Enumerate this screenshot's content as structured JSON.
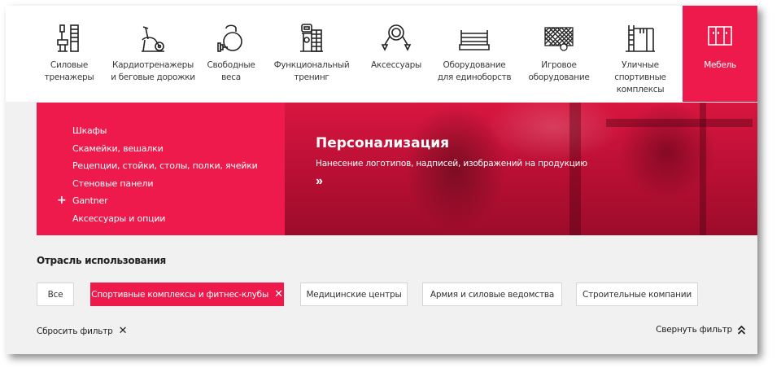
{
  "nav": {
    "items": [
      {
        "label": "Силовые\nтренажеры",
        "icon": "strength-machine-icon"
      },
      {
        "label": "Кардиотренажеры\nи беговые дорожки",
        "icon": "exercise-bike-icon"
      },
      {
        "label": "Свободные\nвеса",
        "icon": "kettlebell-icon"
      },
      {
        "label": "Функциональный\nтренинг",
        "icon": "functional-rack-icon"
      },
      {
        "label": "Аксессуары",
        "icon": "fitness-ring-icon"
      },
      {
        "label": "Оборудование\nдля единоборств",
        "icon": "boxing-ring-icon"
      },
      {
        "label": "Игровое\nоборудование",
        "icon": "goal-net-icon"
      },
      {
        "label": "Уличные\nспортивные\nкомплексы",
        "icon": "outdoor-bars-icon"
      },
      {
        "label": "Мебель",
        "icon": "locker-icon",
        "active": true
      }
    ]
  },
  "submenu": {
    "items": [
      {
        "label": "Шкафы"
      },
      {
        "label": "Скамейки, вешалки"
      },
      {
        "label": "Рецепции, стойки, столы, полки, ячейки"
      },
      {
        "label": "Стеновые панели"
      },
      {
        "label": "Gantner",
        "expandable": "+"
      },
      {
        "label": "Аксессуары и опции"
      }
    ]
  },
  "promo": {
    "title": "Персонализация",
    "subtitle": "Нанесение логотипов, надписей, изображений на продукцию",
    "arrow": "»"
  },
  "filter": {
    "title": "Отрасль использования",
    "chips": [
      {
        "label": "Все"
      },
      {
        "label": "Спортивные комплексы и фитнес-клубы",
        "active": true,
        "remove": "✕"
      },
      {
        "label": "Медицинские центры"
      },
      {
        "label": "Армия и силовые ведомства"
      },
      {
        "label": "Строительные компании"
      }
    ],
    "reset_label": "Сбросить фильтр",
    "reset_icon": "✕",
    "collapse_label": "Свернуть фильтр"
  },
  "colors": {
    "accent": "#ee1a4b",
    "background": "#f1f1f1",
    "nav_bg": "#ffffff",
    "text": "#333333"
  }
}
